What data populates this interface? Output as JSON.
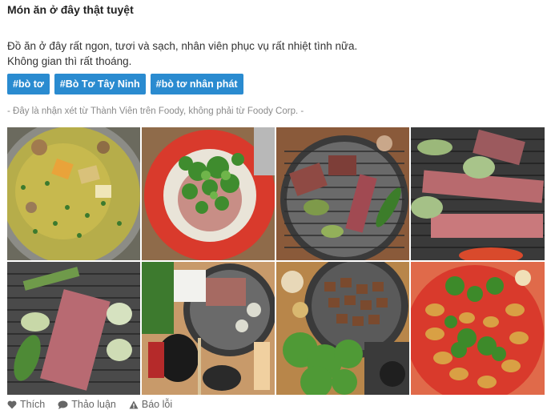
{
  "review": {
    "title": "Món ăn ở đây thật tuyệt",
    "body_line1": "Đồ ăn ở đây rất ngon, tươi và sạch, nhân viên phục vụ rất nhiệt tình nữa.",
    "body_line2": "Không gian thì rất thoáng.",
    "tags": [
      "#bò tơ",
      "#Bò Tơ Tây Ninh",
      "#bò tơ nhân phát"
    ],
    "disclaimer": "- Đây là nhận xét từ Thành Viên trên Foody, không phải từ Foody Corp. -"
  },
  "photos": [
    {
      "subject": "hotpot-soup"
    },
    {
      "subject": "herbs-raw-beef-plate"
    },
    {
      "subject": "grill-beef-vegetables"
    },
    {
      "subject": "grill-beef-strips"
    },
    {
      "subject": "grill-beef-slab"
    },
    {
      "subject": "table-grill-setup"
    },
    {
      "subject": "grill-beef-cubes-salad"
    },
    {
      "subject": "herbs-mushroom-plate"
    }
  ],
  "actions": {
    "like": "Thích",
    "discuss": "Thảo luận",
    "report": "Báo lỗi"
  },
  "colors": {
    "tag_bg": "#2a8bd0",
    "grill_grate": "#555555",
    "plate_red": "#d93a2c"
  },
  "icons": [
    "heart-icon",
    "comment-icon",
    "warning-icon"
  ]
}
